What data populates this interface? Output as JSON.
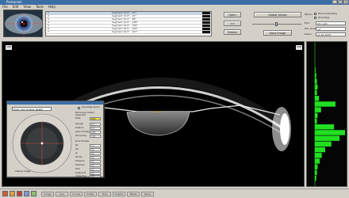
{
  "window": {
    "title": "Pentacam",
    "buttons": [
      "_",
      "□",
      "×"
    ]
  },
  "menu": [
    "File",
    "Edit",
    "View",
    "Tools",
    "Help"
  ],
  "scan_list": {
    "rows": [
      {
        "id": "1",
        "name": "",
        "info": "Segment 13.0° - 13°",
        "selected": true
      },
      {
        "id": "2",
        "name": "",
        "info": "Segment 17.0° - 20°",
        "selected": false
      },
      {
        "id": "3",
        "name": "",
        "info": "Segment 15.0° - 88°",
        "selected": false
      },
      {
        "id": "4",
        "name": "",
        "info": "Segment 14.0° - 188°",
        "selected": false
      },
      {
        "id": "5",
        "name": "",
        "info": "Segment 14.0° - 196°",
        "selected": false
      },
      {
        "id": "6",
        "name": "",
        "info": "Segment 16.0° - 200°",
        "selected": false
      },
      {
        "id": "7",
        "name": "",
        "info": "Segment 16.0° - 201°",
        "selected": false
      }
    ]
  },
  "controls": {
    "open": "Open",
    "add": "<<",
    "remove": ">>",
    "delete": "Delete",
    "global_button": "Global Values",
    "save_image": "Save Image",
    "slider_value": "0",
    "name_label": "Name:",
    "name_value": "",
    "checkbox1": "Show Scheimpflug",
    "checkbox2": "Show Edge",
    "field_labels": [
      "Eye:",
      "Pos. Grad:",
      "Exam:"
    ],
    "field_values": [
      "OD right",
      "12°",
      "12.05.2008"
    ]
  },
  "image_markers": {
    "left": "196",
    "right": "196"
  },
  "popup": {
    "title_field": "Scan: Ant. & Post. Graph",
    "checkbox_label": "Show Edge Vectors",
    "section_a": "Pachymetry Position Dependent",
    "labels_a": [
      "Mode",
      "Average",
      "Distance",
      "Apex to Posterior",
      "Pachymetry"
    ],
    "values_a": [
      "Both",
      "0.0",
      "0.0",
      "0.00",
      "0.00"
    ],
    "section_b": "Zone Ø Center",
    "labels_b": [
      "Rm",
      "Dia",
      "Av",
      "Wh Hrs",
      "Fit Radius",
      "Distortion",
      "Fit Ø",
      "Distance Ø",
      "Inside Zone"
    ],
    "values_b": [
      "1.0",
      "0.0",
      "0.0",
      "0.0",
      "0.0",
      "0.0",
      "0.0",
      "0.0",
      "0.0"
    ],
    "bottom_label": "Anterior Image"
  },
  "toolbar": {
    "tabs": [
      "Image",
      "Lens",
      "Cornea",
      "Profile",
      "Tools",
      "Graphs",
      "Tables",
      "Setup"
    ],
    "icon_colors": [
      "#d85a3a",
      "#e0a040",
      "#c04040",
      "#7a9ad0",
      "#8cc070"
    ]
  },
  "colors": {
    "accent": "#3a6ea5",
    "histogram": "#21e021",
    "marker": "#00ff00"
  },
  "chart_data": {
    "type": "area",
    "values": [
      1,
      2,
      3,
      4,
      3,
      6,
      30,
      9,
      4,
      3,
      28,
      44,
      36,
      24,
      15,
      10,
      7,
      4,
      3,
      2
    ]
  }
}
